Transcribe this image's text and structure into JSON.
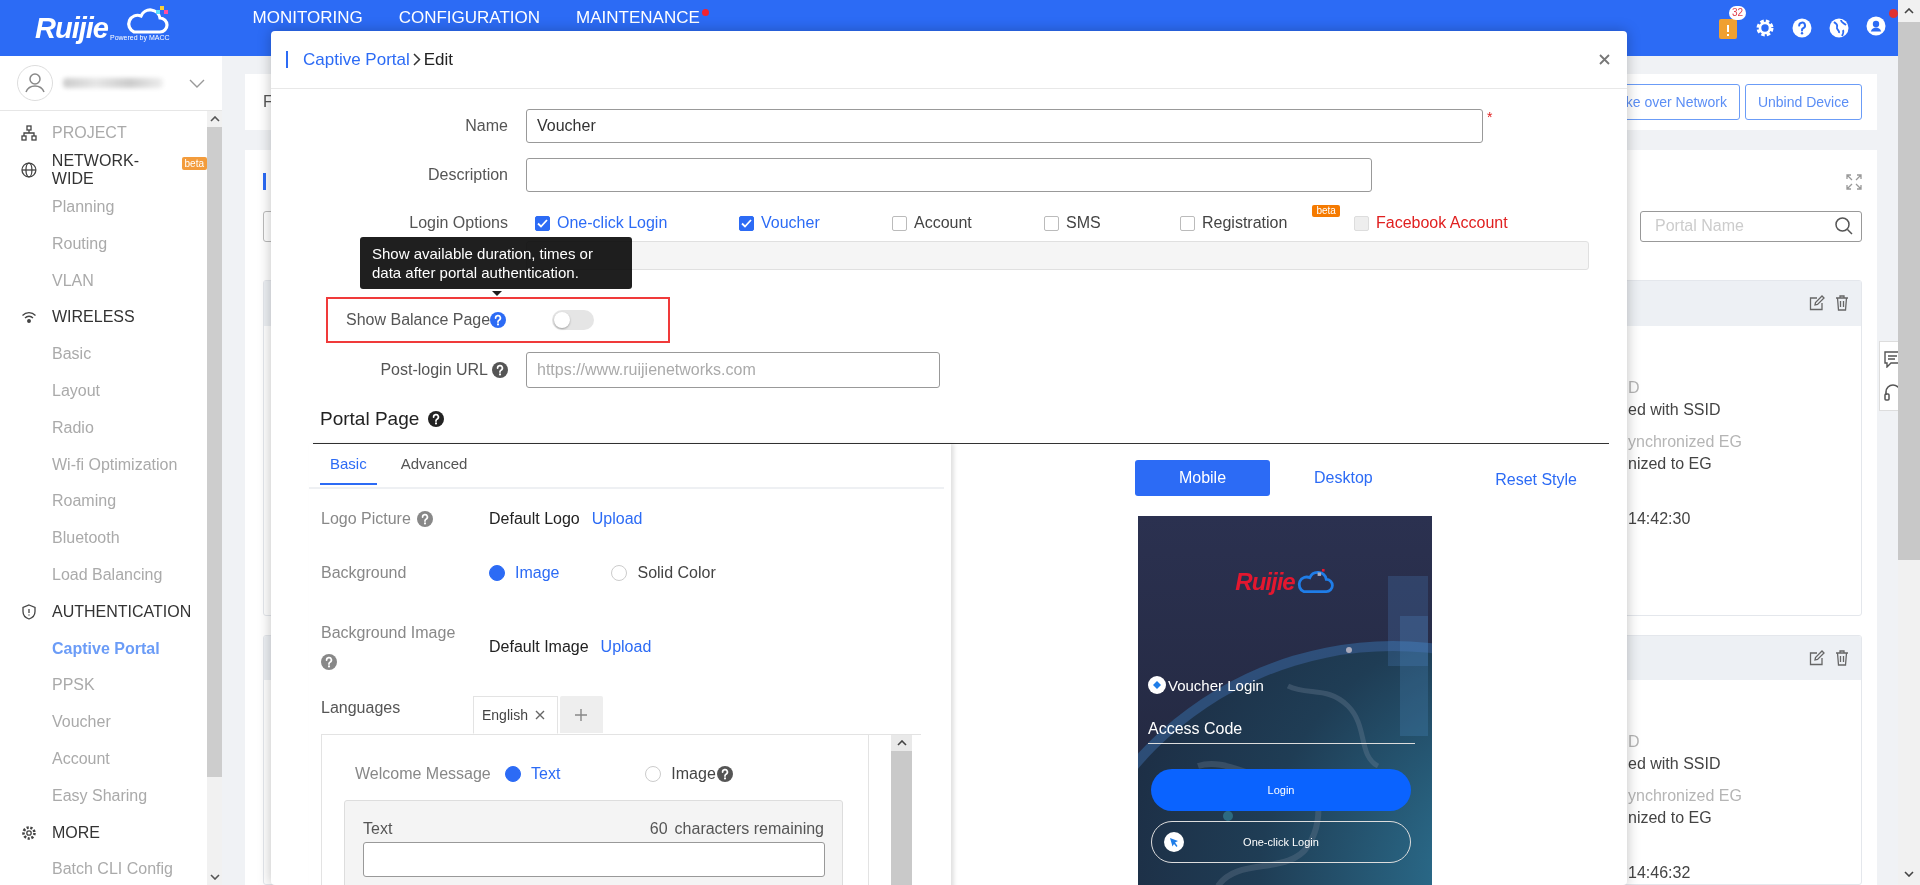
{
  "top_bar": {
    "logo": "Ruijie",
    "logo_tagline": "Powered by MACC",
    "nav": [
      {
        "label": "MONITORING",
        "dot": false
      },
      {
        "label": "CONFIGURATION",
        "dot": false
      },
      {
        "label": "MAINTENANCE",
        "dot": true
      }
    ],
    "notification_count": "32",
    "user_dot": true
  },
  "sidebar": {
    "sections": [
      {
        "label": "PROJECT",
        "kind": "project",
        "disabled": true
      },
      {
        "label": "NETWORK-WIDE",
        "kind": "network",
        "disabled": false,
        "badge": "beta",
        "items": [
          {
            "label": "Planning",
            "selected": false
          },
          {
            "label": "Routing",
            "selected": false
          },
          {
            "label": "VLAN",
            "selected": false
          }
        ]
      },
      {
        "label": "WIRELESS",
        "kind": "wireless",
        "disabled": false,
        "items": [
          {
            "label": "Basic",
            "selected": false
          },
          {
            "label": "Layout",
            "selected": false
          },
          {
            "label": "Radio",
            "selected": false
          },
          {
            "label": "Wi-fi Optimization",
            "selected": false
          },
          {
            "label": "Roaming",
            "selected": false
          },
          {
            "label": "Bluetooth",
            "selected": false
          },
          {
            "label": "Load Balancing",
            "selected": false
          }
        ]
      },
      {
        "label": "AUTHENTICATION",
        "kind": "auth",
        "disabled": false,
        "items": [
          {
            "label": "Captive Portal",
            "selected": true
          },
          {
            "label": "PPSK",
            "selected": false
          },
          {
            "label": "Voucher",
            "selected": false
          },
          {
            "label": "Account",
            "selected": false
          },
          {
            "label": "Easy Sharing",
            "selected": false
          }
        ]
      },
      {
        "label": "MORE",
        "kind": "more",
        "disabled": false,
        "items": [
          {
            "label": "Batch CLI Config",
            "selected": false
          }
        ]
      }
    ]
  },
  "background_page": {
    "fragment": "F",
    "header_buttons": [
      "ke over Network",
      "Unbind Device"
    ],
    "search": {
      "placeholder": "Portal Name"
    },
    "cards": [
      {
        "lines": [
          {
            "text": "D",
            "muted": true
          },
          {
            "text": "ed with SSID",
            "muted": false
          },
          {
            "text": "ynchronized EG",
            "muted": true
          },
          {
            "text": "nized to EG",
            "muted": false
          },
          {
            "text": "14:42:30",
            "muted": false
          }
        ]
      },
      {
        "lines": [
          {
            "text": "D",
            "muted": true
          },
          {
            "text": "ed with SSID",
            "muted": false
          },
          {
            "text": "ynchronized EG",
            "muted": true
          },
          {
            "text": "nized to EG",
            "muted": false
          },
          {
            "text": "14:46:32",
            "muted": false
          }
        ]
      }
    ]
  },
  "modal": {
    "breadcrumb": {
      "parent": "Captive Portal",
      "current": "Edit"
    },
    "form": {
      "name": {
        "label": "Name",
        "value": "Voucher",
        "required_mark": "*"
      },
      "description": {
        "label": "Description"
      },
      "login_options": {
        "label": "Login Options",
        "options": [
          {
            "label": "One-click Login",
            "checked": true,
            "disabled": false
          },
          {
            "label": "Voucher",
            "checked": true,
            "disabled": false
          },
          {
            "label": "Account",
            "checked": false,
            "disabled": false
          },
          {
            "label": "SMS",
            "checked": false,
            "disabled": false
          },
          {
            "label": "Registration",
            "checked": false,
            "disabled": false,
            "badge": "beta"
          },
          {
            "label": "Facebook Account",
            "checked": false,
            "disabled": true
          }
        ]
      },
      "tooltip": "Show available duration, times or data after portal authentication.",
      "balance_page": {
        "label": "Show Balance Page",
        "on": false,
        "highlighted": true
      },
      "post_login_url": {
        "label": "Post-login URL",
        "placeholder": "https://www.ruijienetworks.com"
      }
    },
    "portal_page": {
      "title": "Portal Page",
      "tabs": [
        {
          "label": "Basic",
          "selected": true
        },
        {
          "label": "Advanced",
          "selected": false
        }
      ],
      "logo_picture": {
        "label": "Logo Picture",
        "value": "Default Logo",
        "action": "Upload"
      },
      "background": {
        "label": "Background",
        "options": [
          {
            "label": "Image",
            "selected": true
          },
          {
            "label": "Solid Color",
            "selected": false
          }
        ]
      },
      "background_image": {
        "label": "Background Image",
        "value": "Default Image",
        "action": "Upload"
      },
      "languages": {
        "label": "Languages",
        "tabs": [
          {
            "label": "English",
            "selected": true
          }
        ]
      },
      "welcome": {
        "label": "Welcome Message",
        "options": [
          {
            "label": "Text",
            "selected": true,
            "help": false
          },
          {
            "label": "Image",
            "selected": false,
            "help": true
          }
        ],
        "text_label": "Text",
        "remaining": "60",
        "remaining_label": "characters remaining"
      }
    },
    "preview": {
      "modes": [
        {
          "label": "Mobile",
          "selected": true
        },
        {
          "label": "Desktop",
          "selected": false
        }
      ],
      "reset": "Reset Style",
      "logo": "Ruijie",
      "title": "Voucher Login",
      "field_label": "Access Code",
      "buttons": [
        {
          "label": "Login",
          "kind": "primary"
        },
        {
          "label": "One-click Login",
          "kind": "outline"
        }
      ]
    }
  }
}
